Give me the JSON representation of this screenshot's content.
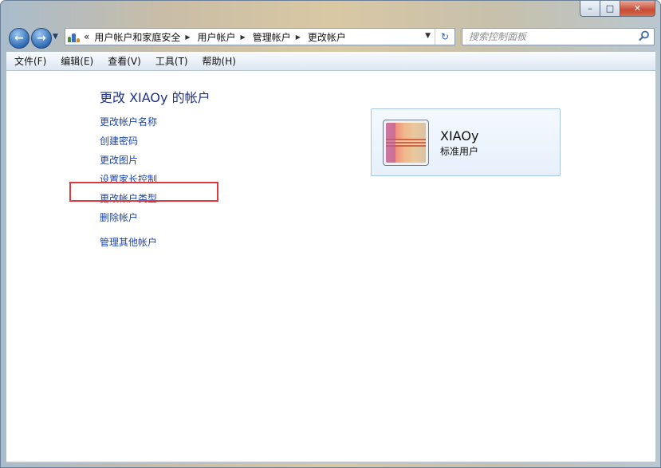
{
  "window": {
    "caption_buttons": {
      "minimize": "–",
      "maximize": "□",
      "close": "✕"
    }
  },
  "nav": {
    "back_glyph": "←",
    "forward_glyph": "→",
    "recent_glyph": "▼",
    "address_prefix": "«",
    "breadcrumbs": [
      "用户帐户和家庭安全",
      "用户帐户",
      "管理帐户",
      "更改帐户"
    ],
    "dropdown_glyph": "▼",
    "refresh_glyph": "↻",
    "search_placeholder": "搜索控制面板"
  },
  "menu": [
    "文件(F)",
    "编辑(E)",
    "查看(V)",
    "工具(T)",
    "帮助(H)"
  ],
  "main": {
    "title": "更改 XIAOy 的帐户",
    "tasks": [
      "更改帐户名称",
      "创建密码",
      "更改图片",
      "设置家长控制",
      "更改帐户类型",
      "删除帐户"
    ],
    "other_link": "管理其他帐户"
  },
  "account": {
    "name": "XIAOy",
    "type": "标准用户"
  },
  "colors": {
    "link": "#1b46b0",
    "title": "#1e3287",
    "highlight": "#e0393e",
    "card_border": "#a8c6e3"
  },
  "icons": {
    "address": "control-panel-icon",
    "search": "magnifier-icon",
    "avatar": "user-picture"
  }
}
